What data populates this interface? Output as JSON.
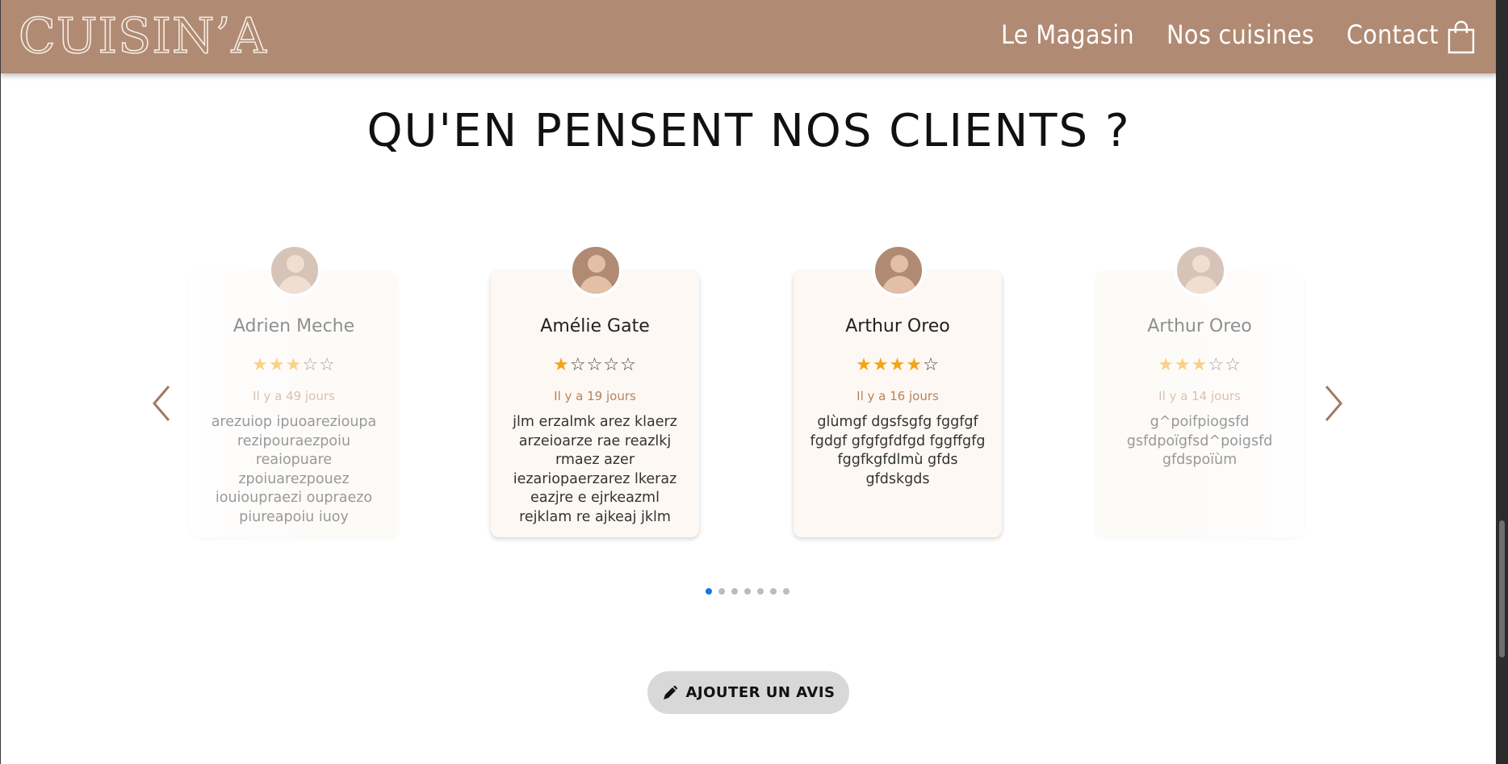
{
  "header": {
    "logo": "CUISIN’A",
    "nav": [
      {
        "label": "Le Magasin"
      },
      {
        "label": "Nos cuisines"
      },
      {
        "label": "Contact"
      }
    ],
    "cart_icon": "shopping-bag-icon"
  },
  "section": {
    "title": "QU'EN PENSENT NOS CLIENTS ?"
  },
  "reviews": [
    {
      "name": "Adrien Meche",
      "rating": 3,
      "date": "Il y a 49 jours",
      "text": "arezuiop ipuoarezioupa rezipouraezpoiu reaiopuare zpoiuarezpouez iouioupraezi oupraezo piureapoiu iuoy"
    },
    {
      "name": "Amélie Gate",
      "rating": 1,
      "date": "Il y a 19 jours",
      "text": "jlm erzalmk arez klaerz arzeioarze rae reazlkj rmaez azer iezariopaerzarez lkeraz eazjre e ejrkeazml rejklam re ajkeaj jklm"
    },
    {
      "name": "Arthur Oreo",
      "rating": 4,
      "date": "Il y a 16 jours",
      "text": "glùmgf dgsfsgfg fggfgf fgdgf gfgfgfdfgd fggffgfg fggfkgfdlmù gfds gfdskgds"
    },
    {
      "name": "Arthur Oreo",
      "rating": 3,
      "date": "Il y a 14 jours",
      "text": "g^poifpiogsfd gsfdpoïgfsd^poigsfd gfdspoïùm"
    }
  ],
  "carousel": {
    "dot_count": 7,
    "active_dot": 0
  },
  "add_review": {
    "label": "AJOUTER UN AVIS",
    "icon": "pen-icon"
  },
  "colors": {
    "header": "#b08a73",
    "star": "#f2a516",
    "date": "#b5835f",
    "dot_active": "#1a73e8"
  }
}
